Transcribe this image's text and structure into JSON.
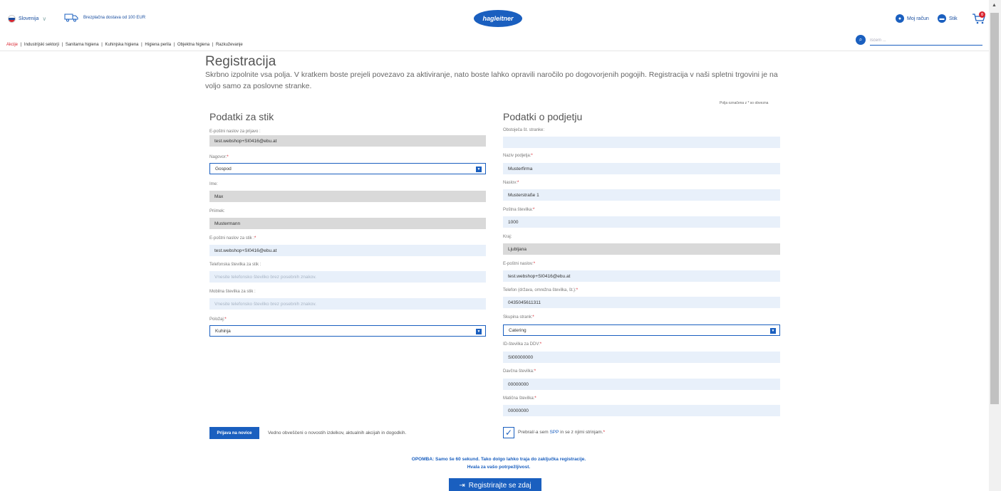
{
  "header": {
    "country": "Slovenija",
    "shipping_text": "Brezplačna dostava od 100 EUR",
    "logo_text": "hagleitner",
    "account_label": "Moj račun",
    "contact_label": "Stik",
    "cart_count": "0"
  },
  "menu": {
    "items": [
      "Akcije",
      "Industrijski sektorji",
      "Sanitarna higiena",
      "Kuhinjska higiena",
      "Higiena perila",
      "Objektna higiena",
      "Razkuževanje"
    ],
    "separator": " | "
  },
  "search": {
    "placeholder": "Iščem ..."
  },
  "page": {
    "title": "Registracija",
    "intro": "Skrbno izpolnite vsa polja. V kratkem boste prejeli povezavo za aktiviranje, nato boste lahko opravili naročilo po dogovorjenih pogojih. Registracija v naši spletni trgovini je na voljo samo za poslovne stranke.",
    "required_note": "Polja označena z * so obvezna"
  },
  "contact": {
    "heading": "Podatki za stik",
    "email_login_label": "E-poštni naslov za prijavo :",
    "email_login_value": "test.webshop+SI0416@ebu.at",
    "salutation_label": "Nagovor:",
    "salutation_value": "Gospod",
    "firstname_label": "Ime:",
    "firstname_value": "Max",
    "lastname_label": "Priimek:",
    "lastname_value": "Mustermann",
    "email_contact_label": "E-poštni naslov za stik :",
    "email_contact_value": "test.webshop+SI0416@ebu.at",
    "phone_label": "Telefonska številka za stik :",
    "phone_placeholder": "Vnesite telefonsko številko brez posebnih znakov.",
    "mobile_label": "Mobilna številka za stik :",
    "mobile_placeholder": "Vnesite telefonsko številko brez posebnih znakov.",
    "position_label": "Položaj:",
    "position_value": "Kuhinja"
  },
  "company": {
    "heading": "Podatki o podjetju",
    "customer_no_label": "Obstoječa št. stranke:",
    "customer_no_value": "",
    "name_label": "Naziv podjetja:",
    "name_value": "Musterfirma",
    "address_label": "Naslov:",
    "address_value": "Musterstraße 1",
    "zip_label": "Poštna številka:",
    "zip_value": "1000",
    "city_label": "Kraj:",
    "city_value": "Ljubljana",
    "email_label": "E-poštni naslov:",
    "email_value": "test.webshop+SI0416@ebu.at",
    "phone_label": "Telefon (država, omrežna številka, št.):",
    "phone_value": "0435045611311",
    "group_label": "Skupina strank:",
    "group_value": "Catering",
    "vat_label": "ID-številka za DDV:",
    "vat_value": "SI00000000",
    "tax_label": "Davčna številka:",
    "tax_value": "00000000",
    "reg_label": "Matična številka:",
    "reg_value": "00000000"
  },
  "newsletter": {
    "button": "Prijava na novice",
    "text": "Vedno obveščeni o novostih izdelkov, aktualnih akcijah in dogodkih."
  },
  "terms": {
    "before": "Prebral/-a sem ",
    "link": "SPP",
    "after": " in se z njimi strinjam."
  },
  "note": {
    "line1": "OPOMBA: Samo še 60 sekund. Tako dolgo lahko traja do zaključka registracije.",
    "line2": "Hvala za vašo potrpežljivost."
  },
  "submit_label": "Registrirajte se zdaj",
  "colors": {
    "accent": "#1a5fbf",
    "required": "#d9232e"
  }
}
